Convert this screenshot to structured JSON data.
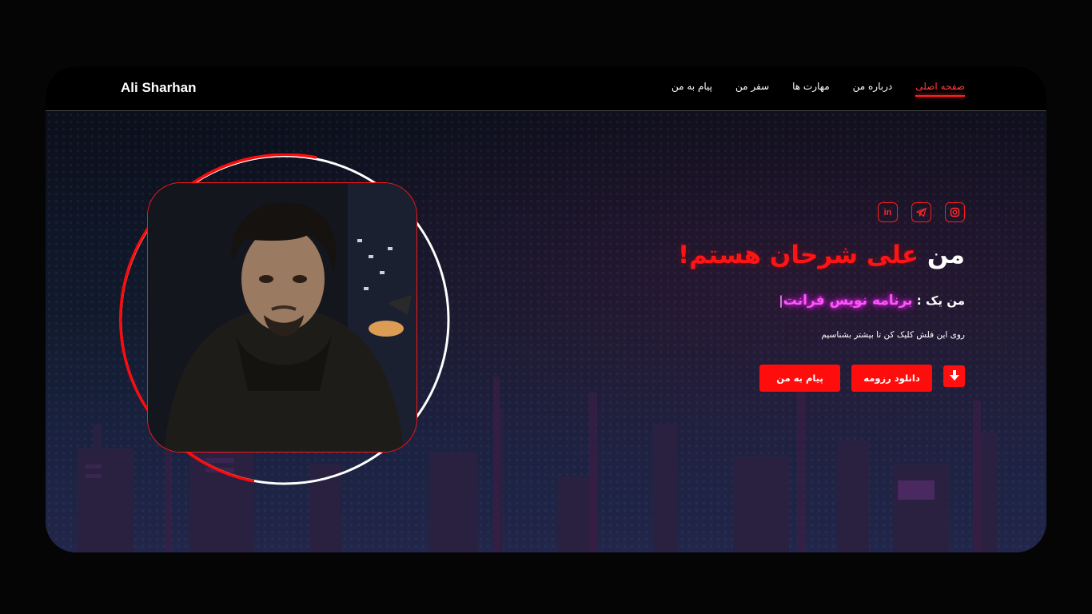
{
  "header": {
    "logo": "Ali Sharhan",
    "nav": [
      {
        "label": "صفحه اصلی",
        "active": true
      },
      {
        "label": "درباره من",
        "active": false
      },
      {
        "label": "مهارت ها",
        "active": false
      },
      {
        "label": "سفر من",
        "active": false
      },
      {
        "label": "پیام به من",
        "active": false
      }
    ]
  },
  "hero": {
    "socials": [
      {
        "icon": "instagram-icon"
      },
      {
        "icon": "telegram-icon"
      },
      {
        "icon": "linkedin-icon",
        "text": "in"
      }
    ],
    "headline_prefix": "من",
    "headline_name": "علی شرحان هستم!",
    "role_prefix": "من یک :",
    "role_value": "برنامه نویس فرانت",
    "role_caret": "|",
    "hint": "روی این فلش کلیک کن تا بیشتر بشناسیم",
    "download_icon": "arrow-down-icon",
    "download_label": "دانلود رزومه",
    "message_label": "پیام به من"
  },
  "colors": {
    "accent": "#ff0d0d",
    "neon": "#ff55ff",
    "background": "#0b0d16"
  }
}
